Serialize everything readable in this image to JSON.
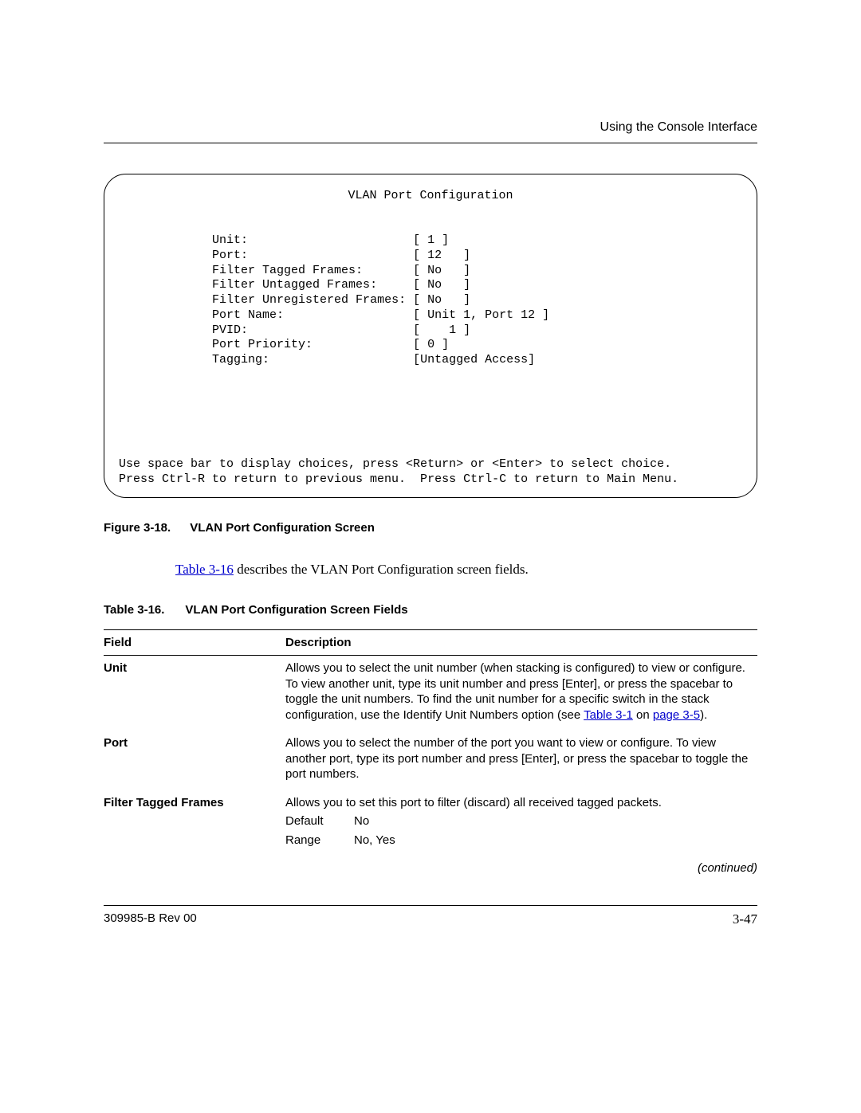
{
  "header": {
    "title": "Using the Console Interface"
  },
  "console": {
    "title": "VLAN Port Configuration",
    "rows": [
      {
        "label": "Unit:",
        "value": "[ 1 ]"
      },
      {
        "label": "Port:",
        "value": "[ 12   ]"
      },
      {
        "label": "Filter Tagged Frames:",
        "value": "[ No   ]"
      },
      {
        "label": "Filter Untagged Frames:",
        "value": "[ No   ]"
      },
      {
        "label": "Filter Unregistered Frames:",
        "value": "[ No   ]"
      },
      {
        "label": "Port Name:",
        "value": "[ Unit 1, Port 12 ]"
      },
      {
        "label": "PVID:",
        "value": "[    1 ]"
      },
      {
        "label": "Port Priority:",
        "value": "[ 0 ]"
      },
      {
        "label": "Tagging:",
        "value": "[Untagged Access]"
      }
    ],
    "help1": "Use space bar to display choices, press <Return> or <Enter> to select choice.",
    "help2": "Press Ctrl-R to return to previous menu.  Press Ctrl-C to return to Main Menu."
  },
  "figure": {
    "num": "Figure 3-18.",
    "title": "VLAN Port Configuration Screen"
  },
  "intro": {
    "link": "Table 3-16",
    "rest": " describes the VLAN Port Configuration screen fields."
  },
  "table": {
    "num": "Table 3-16.",
    "title": "VLAN Port Configuration Screen Fields",
    "head_field": "Field",
    "head_desc": "Description",
    "rows": [
      {
        "field": "Unit",
        "desc_pre": "Allows you to select the unit number (when stacking is configured) to view or configure. To view another unit, type its unit number and press [Enter], or press the spacebar to toggle the unit numbers. To find the unit number for a specific switch in the stack configuration, use the Identify Unit Numbers option (see ",
        "link1": "Table 3-1",
        "mid": " on ",
        "link2": "page 3-5",
        "desc_post": ")."
      },
      {
        "field": "Port",
        "desc": "Allows you to select the number of the port you want to view or configure. To view another port, type its port number and press [Enter], or press the spacebar to toggle the port numbers."
      },
      {
        "field": "Filter Tagged Frames",
        "desc": "Allows you to set this port to filter (discard) all received tagged packets.",
        "default_label": "Default",
        "default_value": "No",
        "range_label": "Range",
        "range_value": "No, Yes"
      }
    ],
    "continued": "(continued)"
  },
  "footer": {
    "doc": "309985-B Rev 00",
    "page": "3-47"
  }
}
